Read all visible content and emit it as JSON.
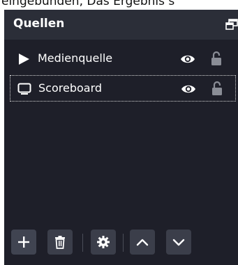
{
  "caption_top": "eingebunden, Das Ergebnis s",
  "panel": {
    "title": "Quellen",
    "undock_icon": "window-restore-icon"
  },
  "sources": [
    {
      "label": "Medienquelle",
      "icon": "play-icon",
      "visible": true,
      "locked": false
    },
    {
      "label": "Scoreboard",
      "icon": "monitor-icon",
      "visible": true,
      "locked": false
    }
  ],
  "toolbar": {
    "add_icon": "plus-icon",
    "remove_icon": "trash-icon",
    "properties_icon": "gear-icon",
    "move_up_icon": "chevron-up-icon",
    "move_down_icon": "chevron-down-icon"
  },
  "colors": {
    "panel_bg": "#1e1f29",
    "header_bg": "#2b2e38",
    "button_bg": "#3b3e4a",
    "text": "#ffffff",
    "lock_icon": "#8a8d96"
  }
}
